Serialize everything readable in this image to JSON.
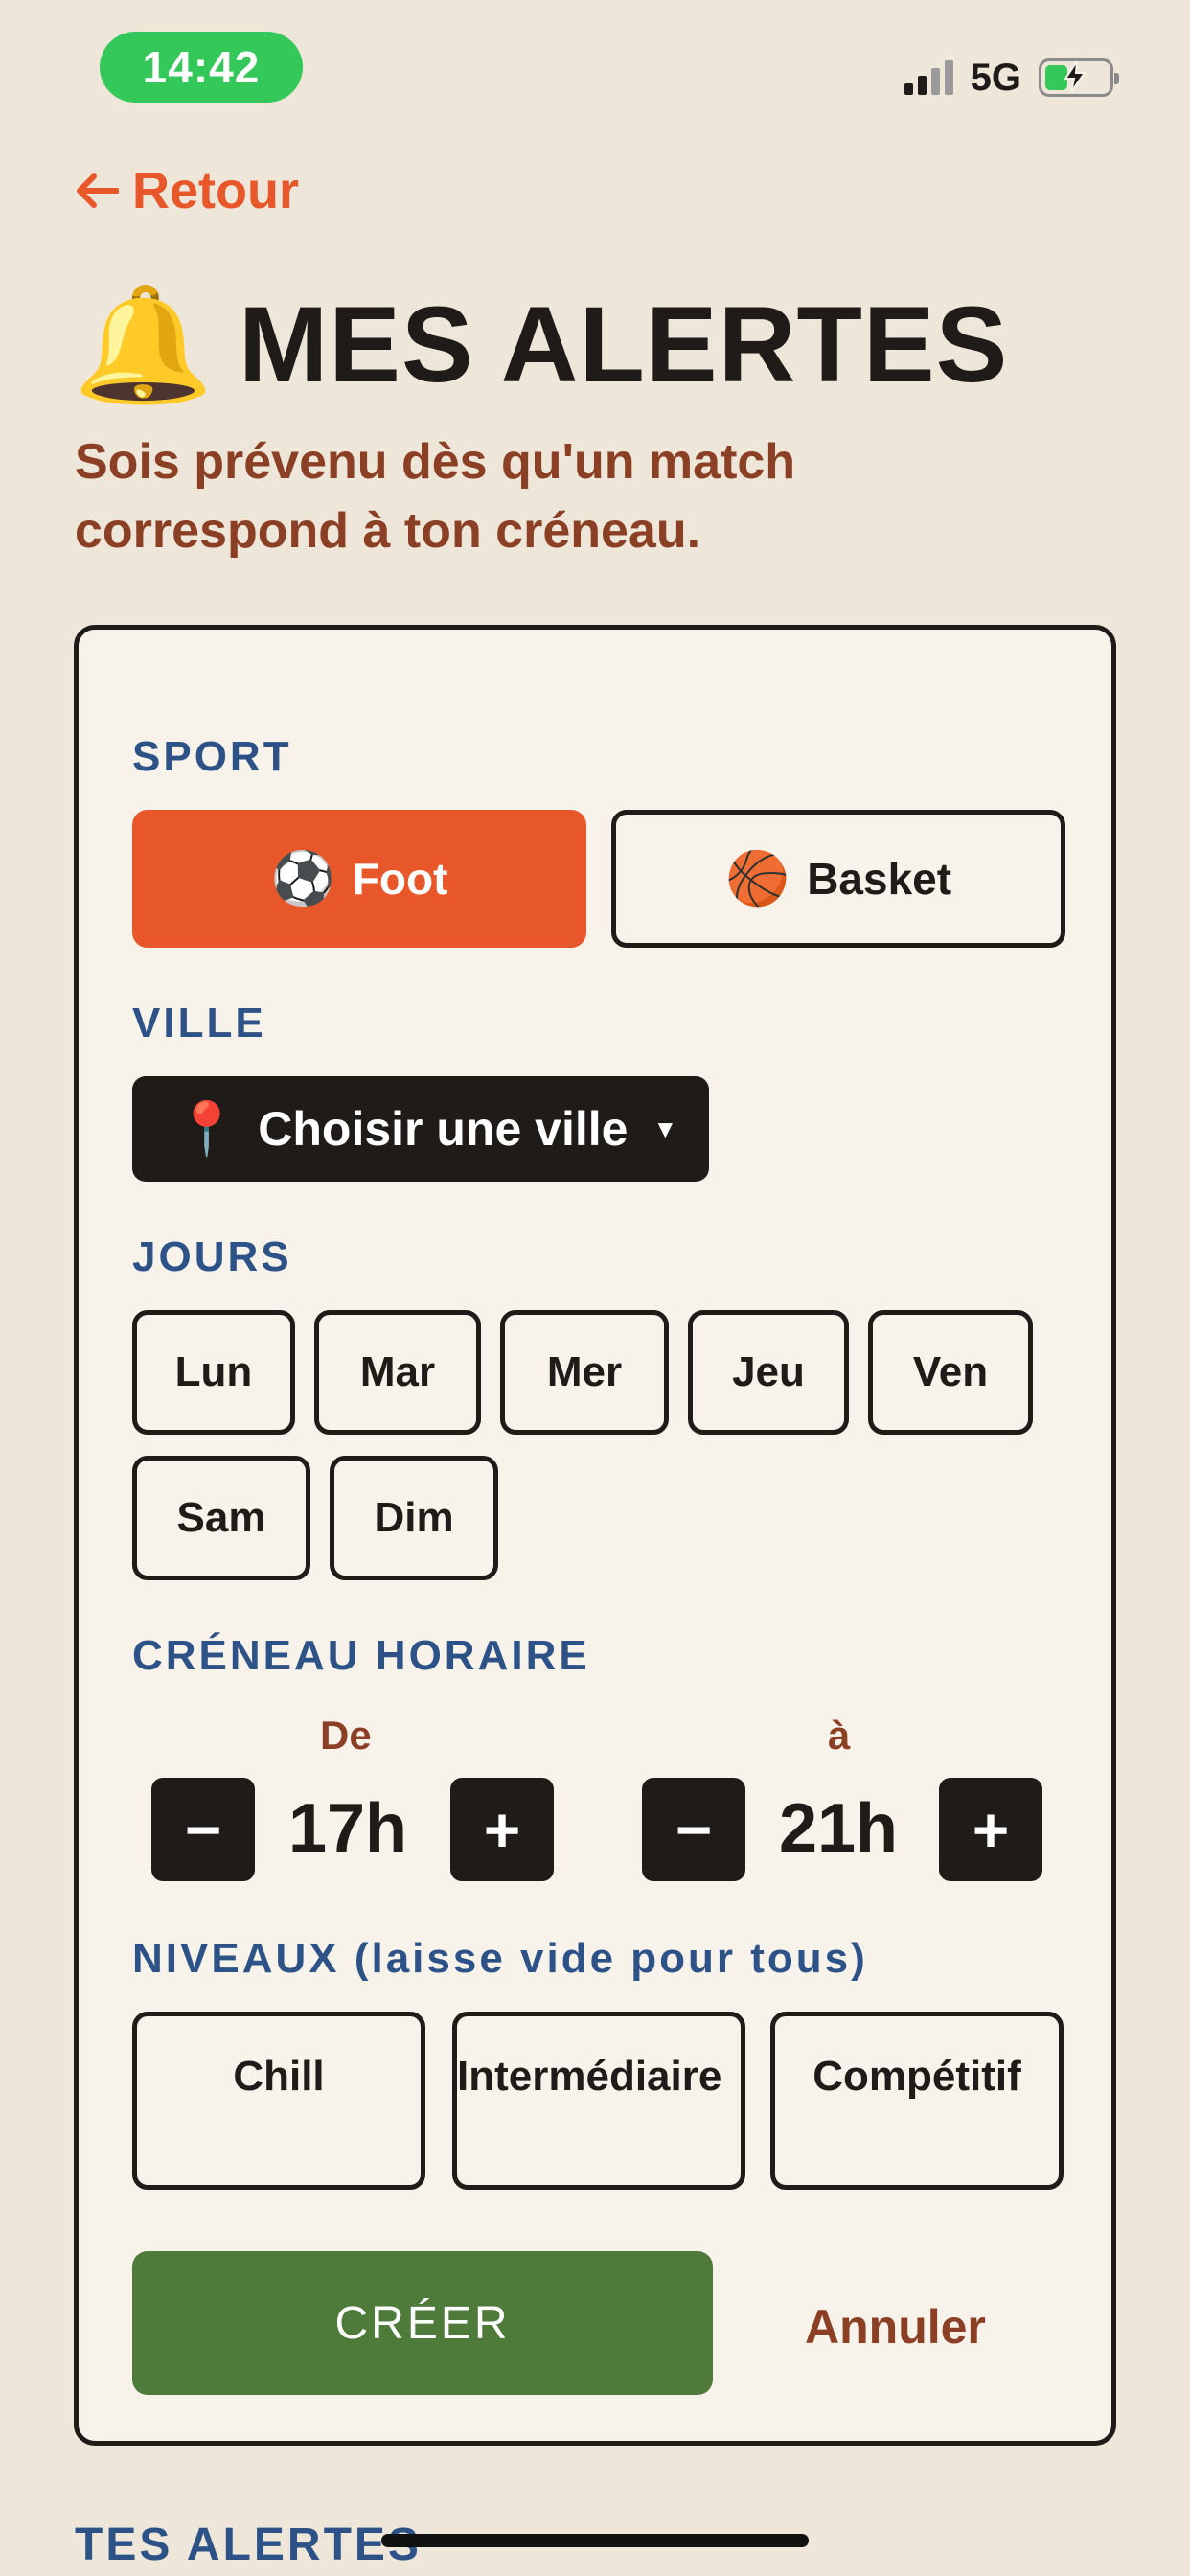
{
  "status_bar": {
    "time": "14:42",
    "network": "5G"
  },
  "nav": {
    "back_label": "Retour",
    "back_icon": "arrow-left-icon"
  },
  "header": {
    "icon": "bell-icon",
    "icon_glyph": "🔔",
    "title": "MES ALERTES",
    "subtitle": "Sois prévenu dès qu'un match correspond à ton créneau."
  },
  "form": {
    "sport": {
      "label": "SPORT",
      "options": [
        {
          "emoji": "⚽",
          "label": "Foot",
          "selected": true
        },
        {
          "emoji": "🏀",
          "label": "Basket",
          "selected": false
        }
      ]
    },
    "city": {
      "label": "VILLE",
      "pin": "📍",
      "value": "Choisir une ville",
      "caret": "▼"
    },
    "days": {
      "label": "JOURS",
      "options": [
        "Lun",
        "Mar",
        "Mer",
        "Jeu",
        "Ven",
        "Sam",
        "Dim"
      ]
    },
    "time_slot": {
      "label": "CRÉNEAU HORAIRE",
      "from": {
        "label": "De",
        "value": "17h"
      },
      "to": {
        "label": "à",
        "value": "21h"
      },
      "minus": "−",
      "plus": "+"
    },
    "levels": {
      "label": "NIVEAUX (laisse vide pour tous)",
      "options": [
        "Chill",
        "Intermédiaire",
        "Compétitif"
      ]
    },
    "create_label": "CRÉER",
    "cancel_label": "Annuler"
  },
  "list": {
    "heading": "TES ALERTES"
  },
  "colors": {
    "accent": "#E8572A",
    "dark": "#1E1B18",
    "green": "#4E7A3A",
    "label_blue": "#2D5287",
    "brown": "#8B4026",
    "background": "#EEE6D8"
  }
}
